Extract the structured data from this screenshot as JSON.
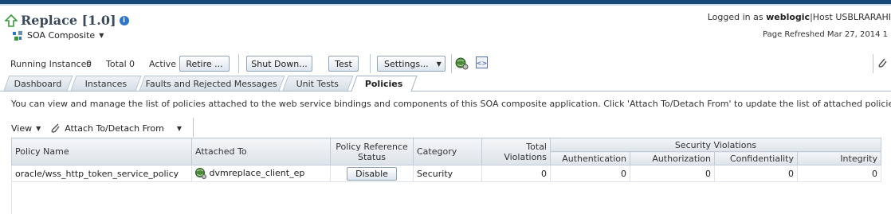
{
  "header": {
    "title": "Replace [1.0]",
    "composite_type": "SOA Composite",
    "login_prefix": "Logged in as",
    "login_user": "weblogic",
    "login_host": "|Host USBLRARAHI",
    "refreshed": "Page Refreshed Mar 27, 2014 1"
  },
  "toolbar": {
    "running_label": "Running Instances",
    "running_value": "0",
    "total_label": "Total",
    "total_value": "0",
    "active_label": "Active",
    "retire": "Retire ...",
    "shutdown": "Shut Down...",
    "test": "Test",
    "settings": "Settings..."
  },
  "tabs": [
    {
      "label": "Dashboard"
    },
    {
      "label": "Instances"
    },
    {
      "label": "Faults and Rejected Messages"
    },
    {
      "label": "Unit Tests"
    },
    {
      "label": "Policies",
      "active": true
    }
  ],
  "description": "You can view and manage the list of policies attached to the web service bindings and components of this SOA composite application. Click 'Attach To/Detach From' to update the list of attached policies.",
  "table_toolbar": {
    "view": "View",
    "attach": "Attach To/Detach From"
  },
  "table": {
    "headers": {
      "policy_name": "Policy Name",
      "attached_to": "Attached To",
      "ref_status": "Policy Reference Status",
      "category": "Category",
      "total_violations": "Total Violations",
      "security_violations": "Security Violations",
      "authentication": "Authentication",
      "authorization": "Authorization",
      "confidentiality": "Confidentiality",
      "integrity": "Integrity"
    },
    "rows": [
      {
        "policy_name": "oracle/wss_http_token_service_policy",
        "attached_to": "dvmreplace_client_ep",
        "ref_status": "Disable",
        "category": "Security",
        "total_violations": "0",
        "authentication": "0",
        "authorization": "0",
        "confidentiality": "0",
        "integrity": "0"
      }
    ]
  },
  "colors": {
    "topbar": "#17487a",
    "link_blue": "#2f76c8",
    "arrow_green": "#3a9a3a"
  }
}
